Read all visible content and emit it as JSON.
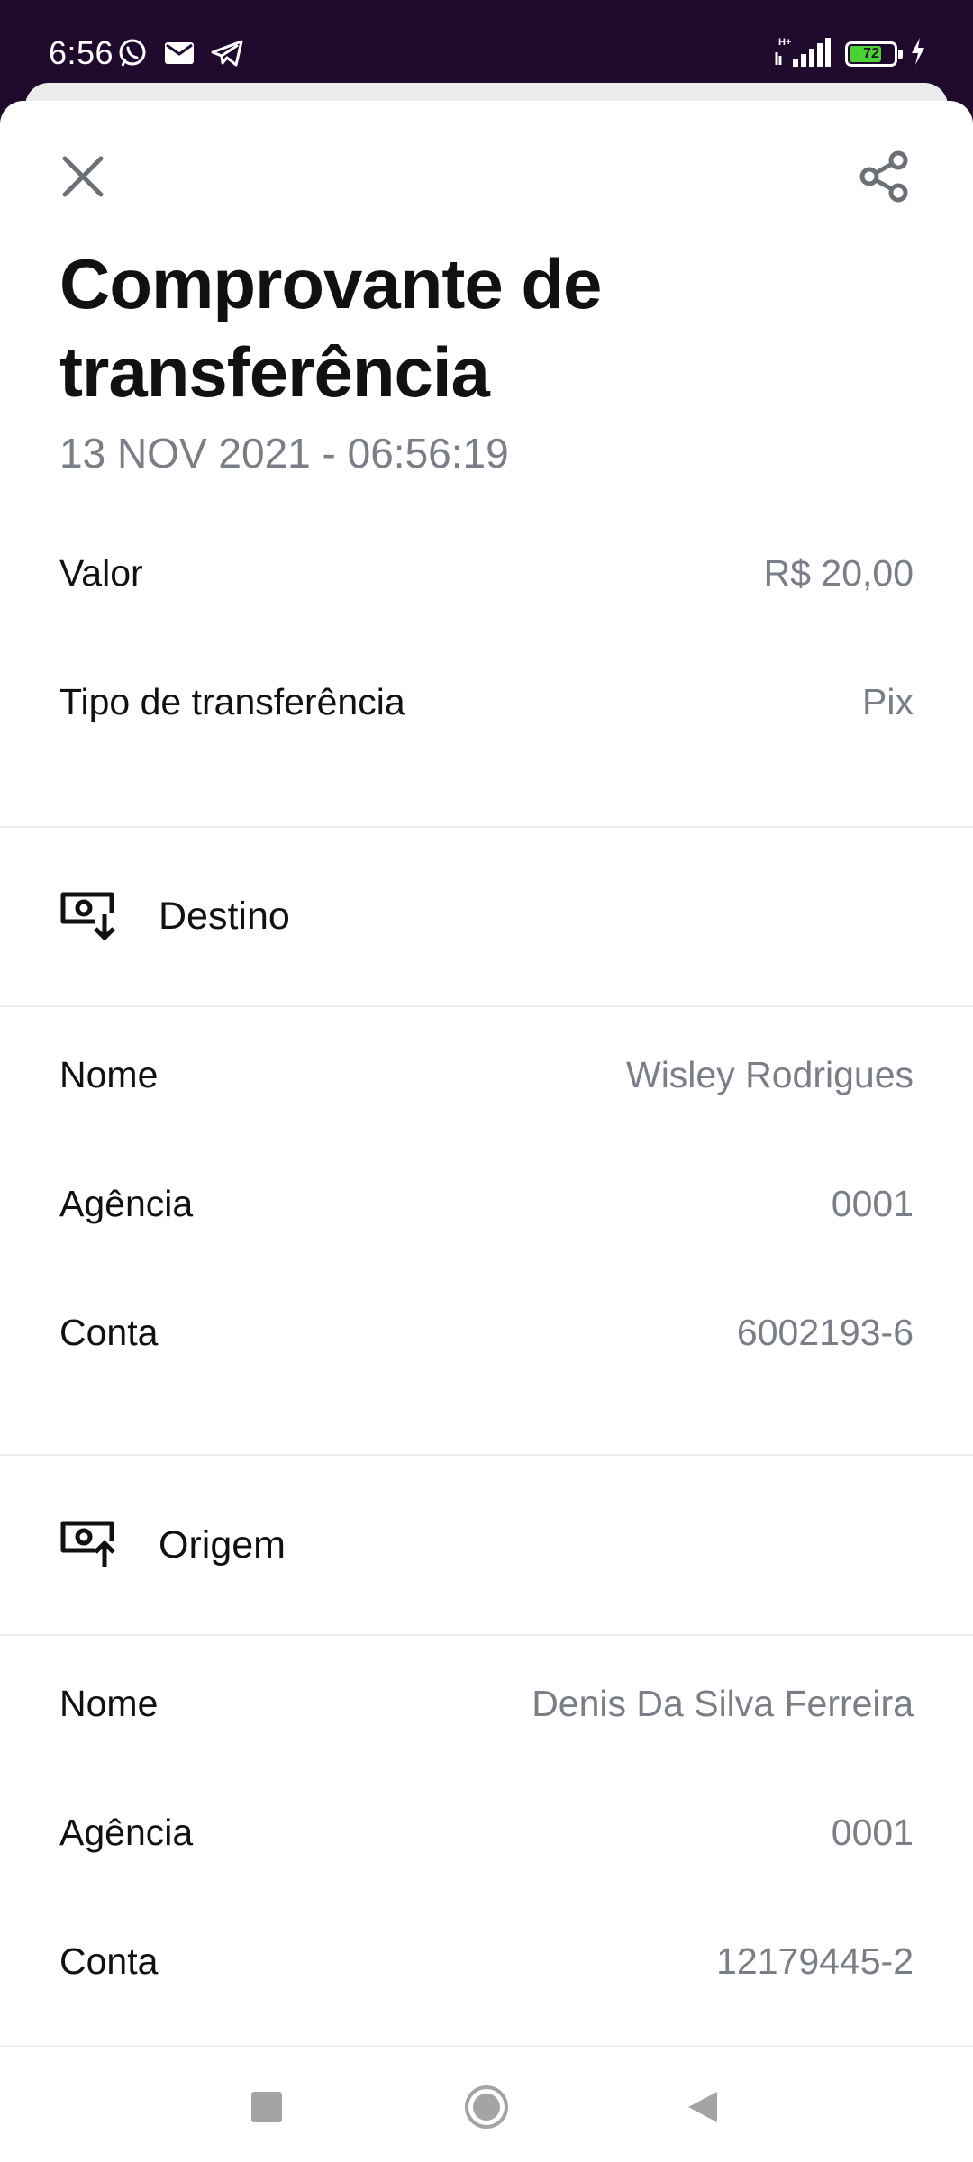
{
  "status_bar": {
    "time": "6:56",
    "battery_level": "72",
    "battery_fraction": 0.72,
    "icons": [
      "whatsapp-icon",
      "mail-icon",
      "telegram-icon",
      "hplus-signal-icon",
      "cellular-signal-icon",
      "battery-icon",
      "charging-icon"
    ],
    "network_label": "H+"
  },
  "header": {
    "close_icon": "close-icon",
    "share_icon": "share-icon"
  },
  "receipt": {
    "title": "Comprovante de transferência",
    "timestamp": "13 NOV 2021 - 06:56:19",
    "amount_label": "Valor",
    "amount_value": "R$ 20,00",
    "type_label": "Tipo de transferência",
    "type_value": "Pix"
  },
  "destination": {
    "section_title": "Destino",
    "icon": "money-incoming-icon",
    "name_label": "Nome",
    "name_value": "Wisley Rodrigues",
    "agency_label": "Agência",
    "agency_value": "0001",
    "account_label": "Conta",
    "account_value": "6002193-6"
  },
  "origin": {
    "section_title": "Origem",
    "icon": "money-outgoing-icon",
    "name_label": "Nome",
    "name_value": "Denis Da Silva Ferreira",
    "agency_label": "Agência",
    "agency_value": "0001",
    "account_label": "Conta",
    "account_value": "12179445-2"
  },
  "nav_bar": {
    "icons": [
      "recents-square-icon",
      "home-circle-icon",
      "back-triangle-icon"
    ]
  },
  "colors": {
    "status_bar_bg": "#1f0a2e",
    "battery_fill": "#4cd137",
    "secondary_text": "#7a7f87",
    "primary_text": "#111111",
    "icon_gray": "#6b6f76"
  }
}
